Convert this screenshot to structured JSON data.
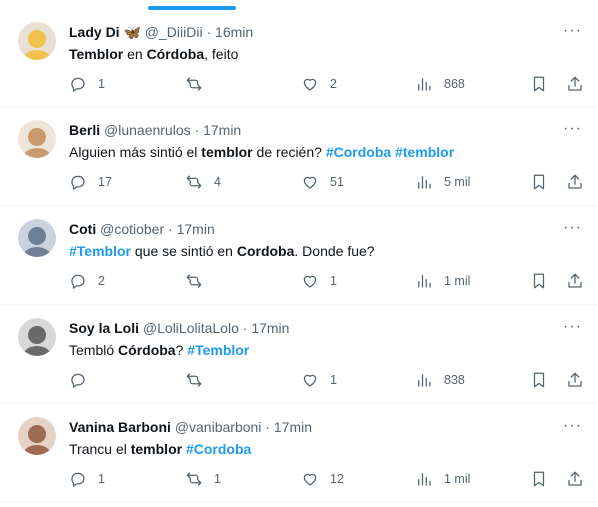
{
  "tweets": [
    {
      "name": "Lady Di",
      "name_emoji": "🦋",
      "handle": "@_DiiiDii",
      "time": "16min",
      "text": [
        {
          "t": "Temblor",
          "s": "bold"
        },
        {
          "t": " en ",
          "s": "plain"
        },
        {
          "t": "Córdoba",
          "s": "bold"
        },
        {
          "t": ", feito",
          "s": "plain"
        }
      ],
      "replies": "1",
      "retweets": "",
      "likes": "2",
      "views": "868",
      "avatar_color": "#f1c24a",
      "avatar_alt": "#e8e0d5"
    },
    {
      "name": "Berli",
      "name_emoji": "",
      "handle": "@lunaenrulos",
      "time": "17min",
      "text": [
        {
          "t": "Alguien más sintió el ",
          "s": "plain"
        },
        {
          "t": "temblor",
          "s": "bold"
        },
        {
          "t": " de recién? ",
          "s": "plain"
        },
        {
          "t": "#Cordoba",
          "s": "tag"
        },
        {
          "t": " ",
          "s": "plain"
        },
        {
          "t": "#temblor",
          "s": "tag"
        }
      ],
      "replies": "17",
      "retweets": "4",
      "likes": "51",
      "views": "5 mil",
      "avatar_color": "#c89a6e",
      "avatar_alt": "#efe4d8"
    },
    {
      "name": "Coti",
      "name_emoji": "",
      "handle": "@cotiober",
      "time": "17min",
      "text": [
        {
          "t": "#Temblor",
          "s": "tag"
        },
        {
          "t": " que se sintió en ",
          "s": "plain"
        },
        {
          "t": "Cordoba",
          "s": "bold"
        },
        {
          "t": ". Donde fue?",
          "s": "plain"
        }
      ],
      "replies": "2",
      "retweets": "",
      "likes": "1",
      "views": "1 mil",
      "avatar_color": "#6d7f95",
      "avatar_alt": "#c9d3df"
    },
    {
      "name": "Soy la Loli",
      "name_emoji": "",
      "handle": "@LoliLolitaLolo",
      "time": "17min",
      "text": [
        {
          "t": "Tembló ",
          "s": "plain"
        },
        {
          "t": "Córdoba",
          "s": "bold"
        },
        {
          "t": "? ",
          "s": "plain"
        },
        {
          "t": "#Temblor",
          "s": "tag"
        }
      ],
      "replies": "",
      "retweets": "",
      "likes": "1",
      "views": "838",
      "avatar_color": "#6a6a6a",
      "avatar_alt": "#d8d8d8"
    },
    {
      "name": "Vanina Barboni",
      "name_emoji": "",
      "handle": "@vanibarboni",
      "time": "17min",
      "text": [
        {
          "t": "Trancu el ",
          "s": "plain"
        },
        {
          "t": "temblor",
          "s": "bold"
        },
        {
          "t": " ",
          "s": "plain"
        },
        {
          "t": "#Cordoba",
          "s": "tag"
        }
      ],
      "replies": "1",
      "retweets": "1",
      "likes": "12",
      "views": "1 mil",
      "avatar_color": "#9c6b52",
      "avatar_alt": "#e6d2c4"
    }
  ],
  "separator": "·",
  "more_glyph": "···"
}
